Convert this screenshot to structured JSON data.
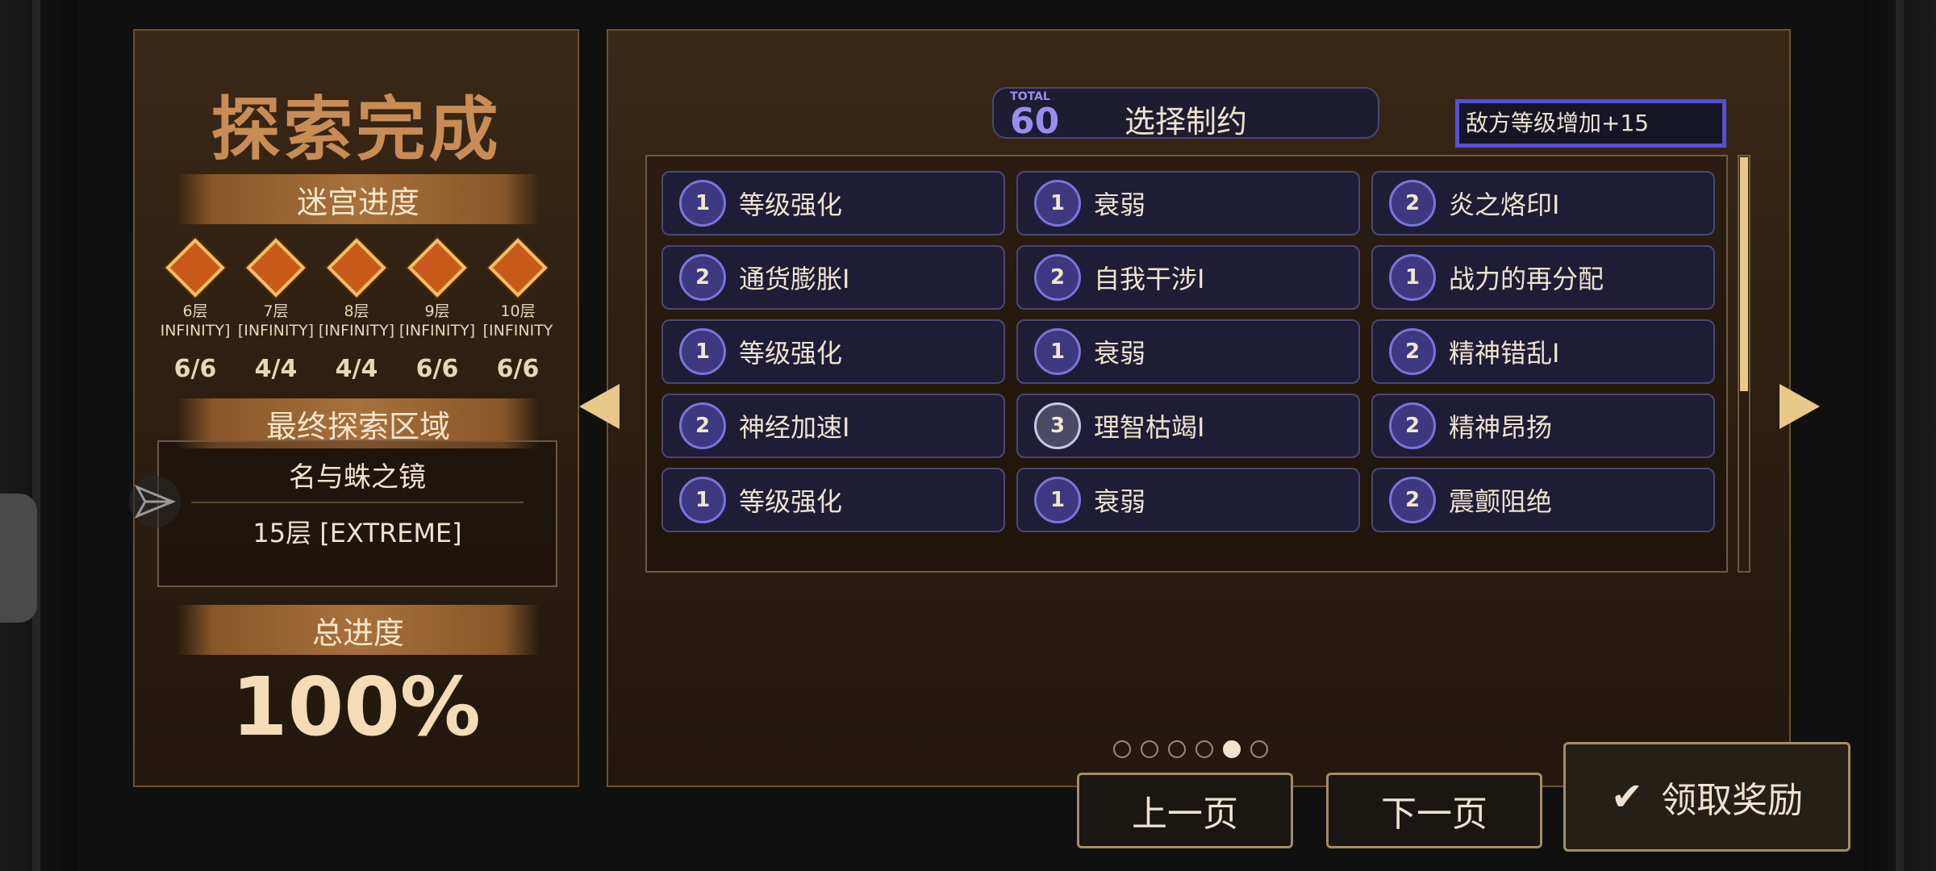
{
  "left": {
    "title": "探索完成",
    "maze_progress_label": "迷宫进度",
    "floors": [
      {
        "label": "6层",
        "mode": "INFINITY]",
        "count": "6/6"
      },
      {
        "label": "7层",
        "mode": "[INFINITY]",
        "count": "4/4"
      },
      {
        "label": "8层",
        "mode": "[INFINITY]",
        "count": "4/4"
      },
      {
        "label": "9层",
        "mode": "[INFINITY]",
        "count": "6/6"
      },
      {
        "label": "10层",
        "mode": "[INFINITY",
        "count": "6/6"
      }
    ],
    "final_area_label": "最终探索区域",
    "area_name": "名与蛛之镜",
    "area_floor": "15层 [EXTREME]",
    "total_progress_label": "总进度",
    "total_progress": "100%"
  },
  "header": {
    "total_tag": "TOTAL",
    "total_value": "60",
    "title": "选择制约"
  },
  "tooltip": "敌方等级增加+15",
  "constraints": [
    {
      "level": "1",
      "label": "等级强化"
    },
    {
      "level": "1",
      "label": "衰弱"
    },
    {
      "level": "2",
      "label": "炎之烙印I"
    },
    {
      "level": "2",
      "label": "通货膨胀I"
    },
    {
      "level": "2",
      "label": "自我干涉I"
    },
    {
      "level": "1",
      "label": "战力的再分配"
    },
    {
      "level": "1",
      "label": "等级强化"
    },
    {
      "level": "1",
      "label": "衰弱"
    },
    {
      "level": "2",
      "label": "精神错乱I"
    },
    {
      "level": "2",
      "label": "神经加速I"
    },
    {
      "level": "3",
      "label": "理智枯竭I"
    },
    {
      "level": "2",
      "label": "精神昂扬"
    },
    {
      "level": "1",
      "label": "等级强化"
    },
    {
      "level": "1",
      "label": "衰弱"
    },
    {
      "level": "2",
      "label": "震颤阻绝"
    }
  ],
  "pagination": {
    "total_pages": 6,
    "current_page": 5
  },
  "buttons": {
    "prev": "上一页",
    "next": "下一页",
    "claim": "领取奖励"
  },
  "colors": {
    "accent_purple": "#5550d8",
    "gold": "#e8c98a",
    "panel_brown": "#2b1d10"
  }
}
